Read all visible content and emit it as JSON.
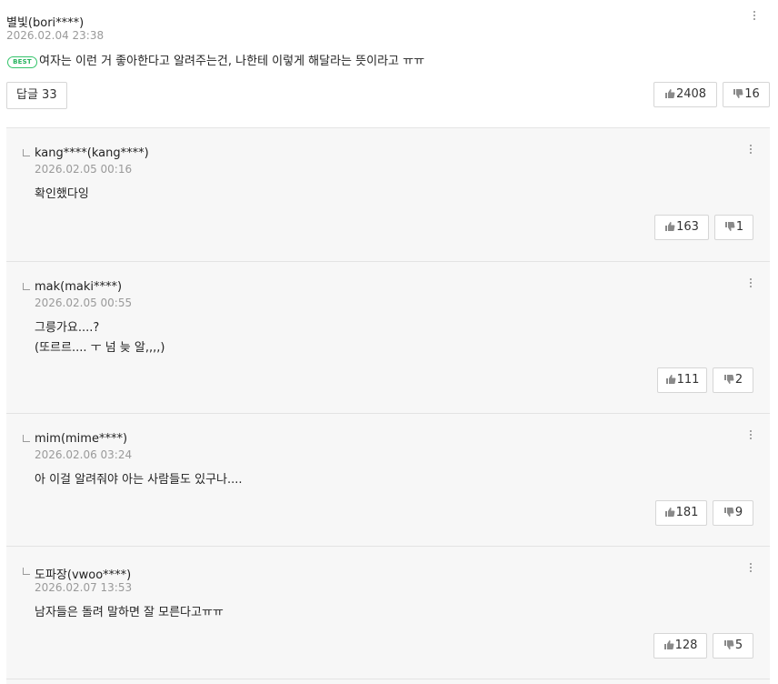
{
  "main_comment": {
    "author": "별빛(bori****)",
    "date": "2026.02.04 23:38",
    "badge": "BEST",
    "text": "여자는 이런 거 좋아한다고 알려주는건, 나한테 이렇게 해달라는 뜻이라고 ㅠㅠ",
    "reply_label": "답글 33",
    "likes": "2408",
    "dislikes": "16"
  },
  "replies": [
    {
      "author": "kang****(kang****)",
      "date": "2026.02.05 00:16",
      "text": "확인했다잉",
      "likes": "163",
      "dislikes": "1"
    },
    {
      "author": "mak(maki****)",
      "date": "2026.02.05 00:55",
      "text": "그릉가요....?\n(또르르.... ㅜ 넘 늦 알,,,,)",
      "likes": "111",
      "dislikes": "2"
    },
    {
      "author": "mim(mime****)",
      "date": "2026.02.06 03:24",
      "text": "아 이걸 알려줘야 아는 사람들도 있구나....",
      "likes": "181",
      "dislikes": "9"
    },
    {
      "author": "도파장(vwoo****)",
      "date": "2026.02.07 13:53",
      "text": "남자들은 돌려 말하면 잘 모른다고ㅠㅠ",
      "likes": "128",
      "dislikes": "5"
    }
  ],
  "icons": {
    "like": "thumbs-up-icon",
    "dislike": "thumbs-down-icon",
    "more": "more-vertical-icon",
    "reply_indicator": "reply-indicator-icon"
  },
  "colors": {
    "best_badge": "#35c46b",
    "reply_background": "#f7f7f7",
    "secondary_text": "#9a9a9a",
    "border": "#d6d6d6"
  }
}
